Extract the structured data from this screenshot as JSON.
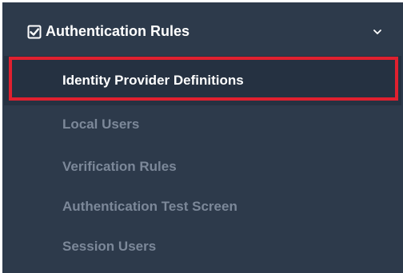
{
  "menu": {
    "group": {
      "title": "Authentication Rules",
      "icon": "checkbox-icon",
      "expanded": true
    },
    "items": [
      {
        "label": "Identity Provider Definitions",
        "active": true
      },
      {
        "label": "Local Users",
        "active": false
      },
      {
        "label": "Verification Rules",
        "active": false
      },
      {
        "label": "Authentication Test Screen",
        "active": false
      },
      {
        "label": "Session Users",
        "active": false
      }
    ]
  },
  "colors": {
    "sidebar_bg": "#2d3a4b",
    "active_row_bg": "#253141",
    "highlight": "#e0202f",
    "inactive_text": "#7c8899",
    "active_text": "#ffffff"
  }
}
